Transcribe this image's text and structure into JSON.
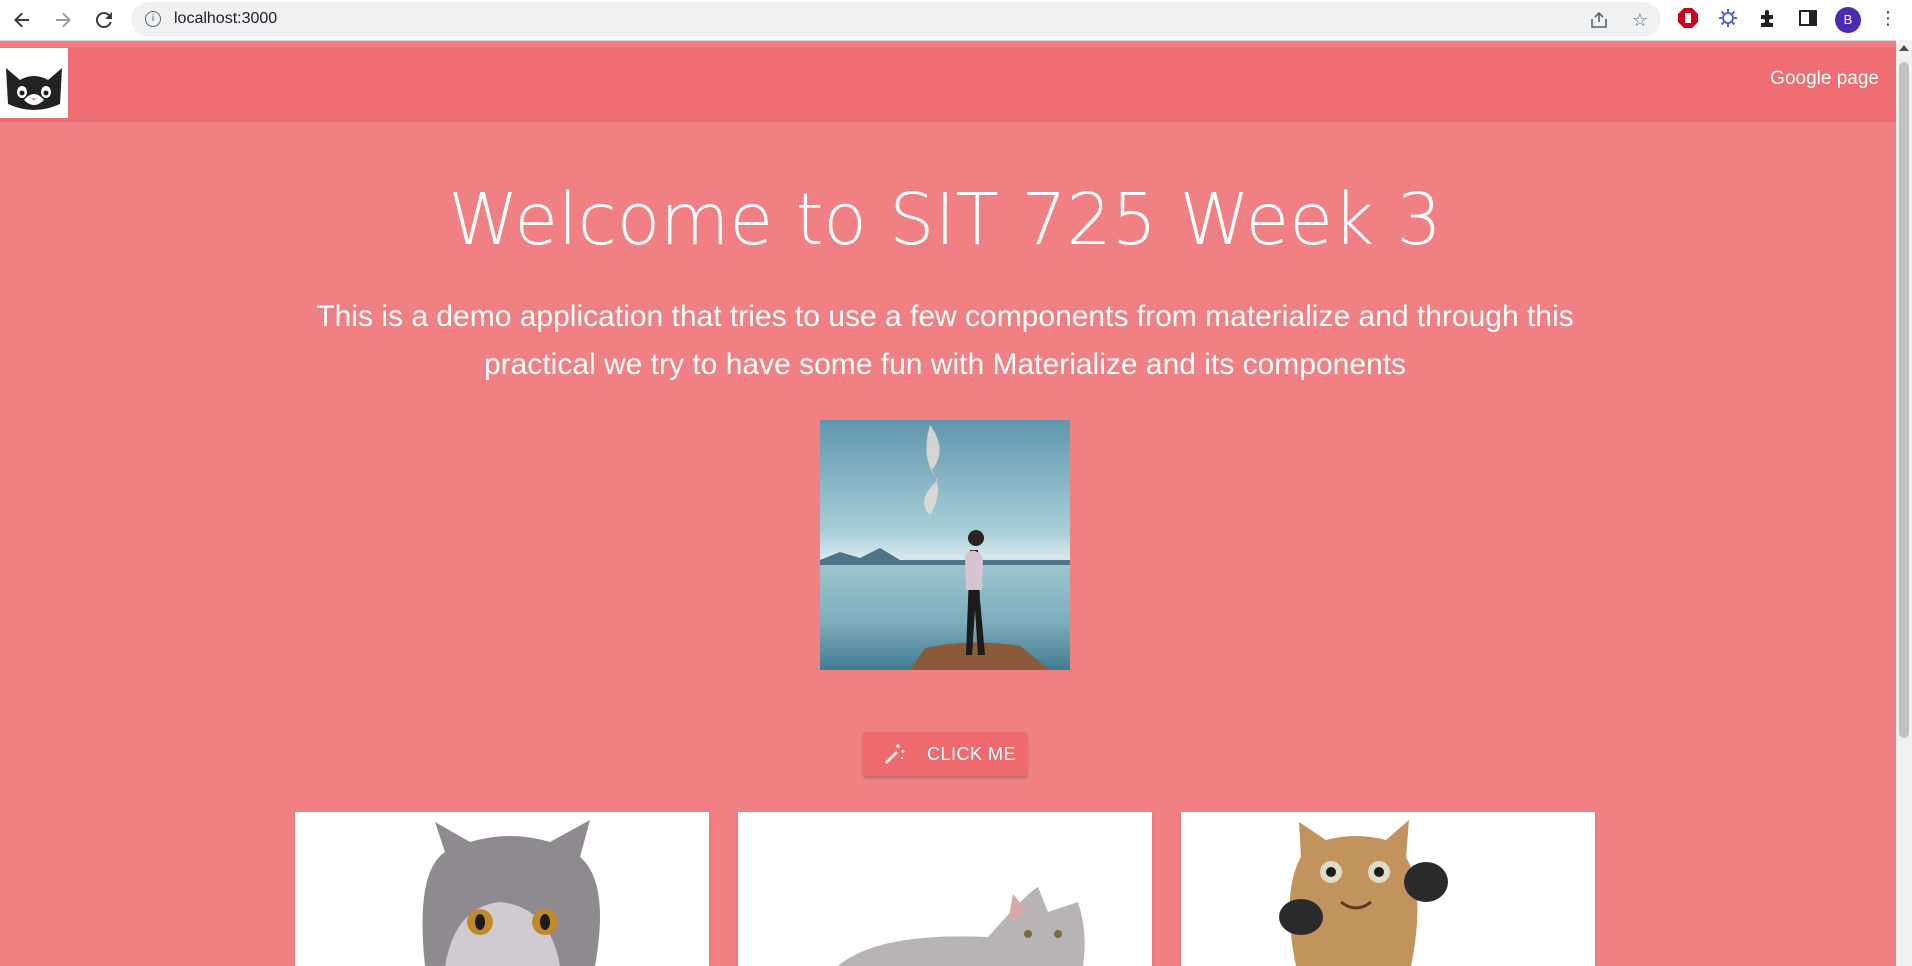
{
  "browser": {
    "url": "localhost:3000",
    "profile_initial": "B",
    "back_icon": "arrow-left-icon",
    "forward_icon": "arrow-right-icon",
    "reload_icon": "reload-icon"
  },
  "navbar": {
    "link_label": "Google page",
    "background": "#ee6e73",
    "logo_icon": "cat-face-icon"
  },
  "hero": {
    "title": "Welcome to SIT 725 Week 3",
    "subtitle": "This is a demo application that tries to use a few components from materialize and through this practical we try to have some fun with Materialize and its components",
    "image_alt": "person standing by a lake"
  },
  "button": {
    "label": "CLICK ME",
    "icon": "magic-wand-icon"
  },
  "cards": [
    {
      "subject": "grey british shorthair kitten"
    },
    {
      "subject": "grey cat lying down"
    },
    {
      "subject": "tabby cat with raised paws"
    }
  ],
  "colors": {
    "page_background": "#f08083",
    "navbar": "#ee6e73",
    "button": "#ef6a6f",
    "text": "#ffffff"
  }
}
